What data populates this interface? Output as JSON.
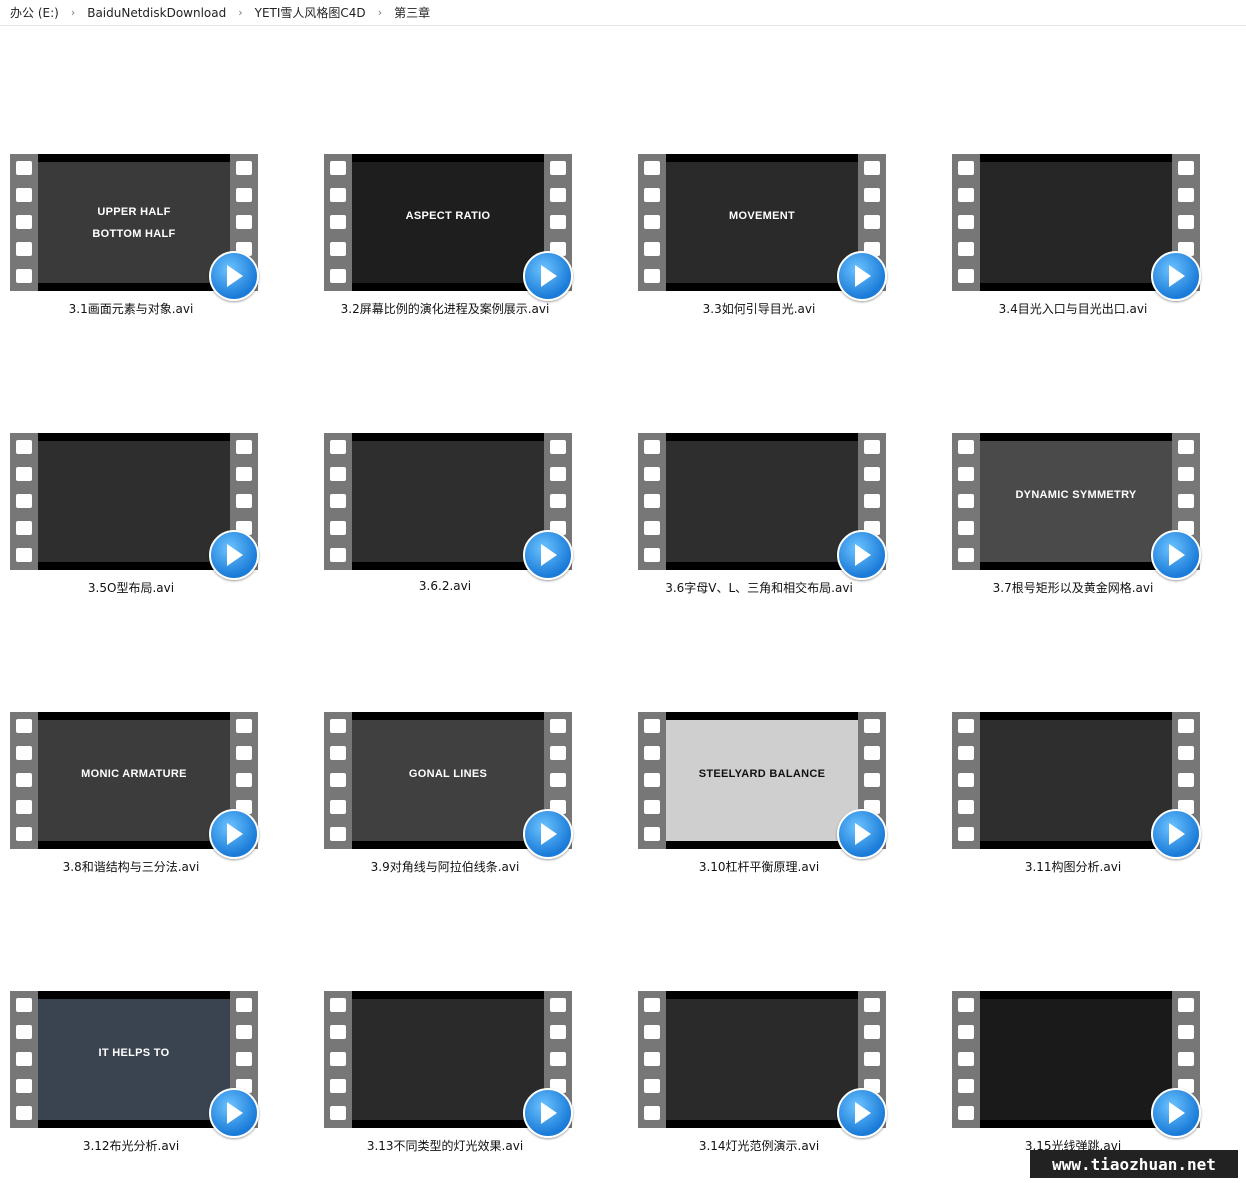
{
  "breadcrumb": [
    "办公 (E:)",
    "BaiduNetdiskDownload",
    "YETI雪人风格图C4D",
    "第三章"
  ],
  "files": [
    {
      "name": "3.1画面元素与对象.avi",
      "thumb_text": "UPPER HALF\nBOTTOM HALF",
      "bg": "#3a3a3a"
    },
    {
      "name": "3.2屏幕比例的演化进程及案例展示.avi",
      "thumb_text": "ASPECT RATIO",
      "bg": "#1e1e1e"
    },
    {
      "name": "3.3如何引导目光.avi",
      "thumb_text": "MOVEMENT",
      "bg": "#2a2a2a"
    },
    {
      "name": "3.4目光入口与目光出口.avi",
      "thumb_text": "",
      "bg": "#262626"
    },
    {
      "name": "3.5O型布局.avi",
      "thumb_text": "",
      "bg": "#2e2e2e"
    },
    {
      "name": "3.6.2.avi",
      "thumb_text": "",
      "bg": "#2e2e2e"
    },
    {
      "name": "3.6字母V、L、三角和相交布局.avi",
      "thumb_text": "",
      "bg": "#2e2e2e"
    },
    {
      "name": "3.7根号矩形以及黄金网格.avi",
      "thumb_text": "DYNAMIC SYMMETRY",
      "bg": "#4a4a4a"
    },
    {
      "name": "3.8和谐结构与三分法.avi",
      "thumb_text": "MONIC ARMATURE",
      "bg": "#3c3c3c"
    },
    {
      "name": "3.9对角线与阿拉伯线条.avi",
      "thumb_text": "GONAL LINES",
      "bg": "#404040"
    },
    {
      "name": "3.10杠杆平衡原理.avi",
      "thumb_text": "STEELYARD BALANCE",
      "bg": "#cfcfcf"
    },
    {
      "name": "3.11构图分析.avi",
      "thumb_text": "",
      "bg": "#2e2e2e"
    },
    {
      "name": "3.12布光分析.avi",
      "thumb_text": "IT HELPS TO",
      "bg": "#3a4450"
    },
    {
      "name": "3.13不同类型的灯光效果.avi",
      "thumb_text": "",
      "bg": "#2a2a2a"
    },
    {
      "name": "3.14灯光范例演示.avi",
      "thumb_text": "",
      "bg": "#2a2a2a"
    },
    {
      "name": "3.15光线弹跳.avi",
      "thumb_text": "",
      "bg": "#1a1a1a"
    }
  ],
  "watermark": "www.tiaozhuan.net"
}
